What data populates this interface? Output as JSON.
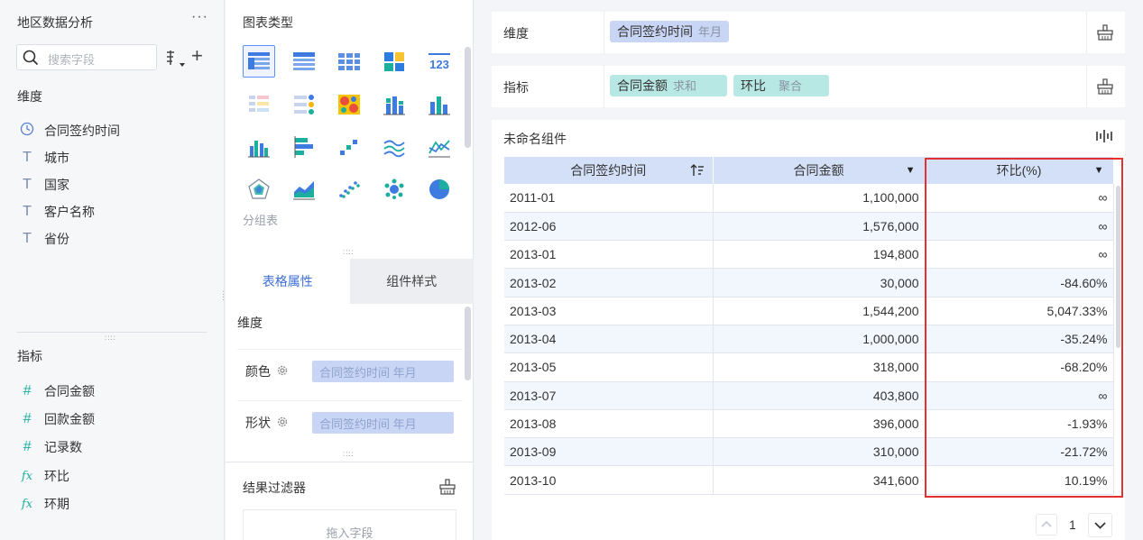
{
  "left_panel": {
    "title": "地区数据分析",
    "more": "···",
    "search_placeholder": "搜索字段",
    "dimension_label": "维度",
    "dimensions": [
      {
        "label": "合同签约时间",
        "icon": "clock-icon"
      },
      {
        "label": "城市",
        "icon": "text-type-icon"
      },
      {
        "label": "国家",
        "icon": "text-type-icon"
      },
      {
        "label": "客户名称",
        "icon": "text-type-icon"
      },
      {
        "label": "省份",
        "icon": "text-type-icon"
      }
    ],
    "measure_label": "指标",
    "measures": [
      {
        "label": "合同金额",
        "icon": "number-type-icon"
      },
      {
        "label": "回款金额",
        "icon": "number-type-icon"
      },
      {
        "label": "记录数",
        "icon": "number-type-icon"
      },
      {
        "label": "环比",
        "icon": "formula-icon"
      },
      {
        "label": "环期",
        "icon": "formula-icon"
      }
    ]
  },
  "middle_panel": {
    "chart_type_title": "图表类型",
    "chart_type_hover_label": "分组表",
    "tabs": [
      "表格属性",
      "组件样式"
    ],
    "dimension_label": "维度",
    "properties": [
      {
        "label": "颜色",
        "value": "合同签约时间 年月"
      },
      {
        "label": "形状",
        "value": "合同签约时间 年月"
      }
    ],
    "filter_title": "结果过滤器",
    "filter_placeholder": "拖入字段"
  },
  "right_panel": {
    "dimension_shelf_label": "维度",
    "dimension_pill": {
      "name": "合同签约时间",
      "agg": "年月"
    },
    "measure_shelf_label": "指标",
    "measure_pills": [
      {
        "name": "合同金额",
        "agg": "求和"
      },
      {
        "name": "环比",
        "agg": "聚合"
      }
    ],
    "widget_title": "未命名组件",
    "table": {
      "headers": [
        "合同签约时间",
        "合同金额",
        "环比(%)"
      ],
      "rows": [
        [
          "2011-01",
          "1,100,000",
          "∞"
        ],
        [
          "2012-06",
          "1,576,000",
          "∞"
        ],
        [
          "2013-01",
          "194,800",
          "∞"
        ],
        [
          "2013-02",
          "30,000",
          "-84.60%"
        ],
        [
          "2013-03",
          "1,544,200",
          "5,047.33%"
        ],
        [
          "2013-04",
          "1,000,000",
          "-35.24%"
        ],
        [
          "2013-05",
          "318,000",
          "-68.20%"
        ],
        [
          "2013-07",
          "403,800",
          "∞"
        ],
        [
          "2013-08",
          "396,000",
          "-1.93%"
        ],
        [
          "2013-09",
          "310,000",
          "-21.72%"
        ],
        [
          "2013-10",
          "341,600",
          "10.19%"
        ]
      ]
    },
    "pager_page": "1"
  },
  "colors": {
    "accent": "#3d6fd6",
    "dimension_pill": "#c8d5f5",
    "measure_pill": "#b8e8e4",
    "table_header": "#d4e0f7",
    "highlight_box": "#e53030"
  }
}
